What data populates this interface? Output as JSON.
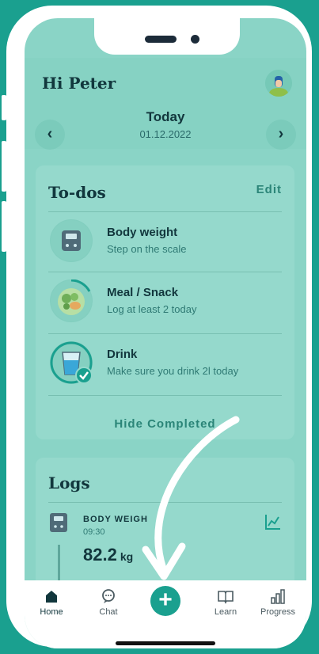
{
  "header": {
    "greeting": "Hi Peter",
    "date_title": "Today",
    "date_value": "01.12.2022",
    "prev_icon": "chevron-left-icon",
    "next_icon": "chevron-right-icon"
  },
  "todos": {
    "title": "To-dos",
    "edit_label": "Edit",
    "items": [
      {
        "title": "Body weight",
        "subtitle": "Step on the scale",
        "icon": "scale-icon"
      },
      {
        "title": "Meal / Snack",
        "subtitle": "Log at least 2 today",
        "icon": "meal-plate-icon"
      },
      {
        "title": "Drink",
        "subtitle": "Make sure you drink 2l today",
        "icon": "water-glass-icon"
      }
    ],
    "hide_completed_label": "Hide Completed"
  },
  "logs": {
    "title": "Logs",
    "entry_name": "BODY WEIGH",
    "entry_time": "09:30",
    "entry_value": "82.2",
    "entry_unit": "kg"
  },
  "tabs": [
    {
      "label": "Home",
      "icon": "home-icon",
      "active": true
    },
    {
      "label": "Chat",
      "icon": "chat-icon",
      "active": false
    },
    {
      "label": "Learn",
      "icon": "book-icon",
      "active": false
    },
    {
      "label": "Progress",
      "icon": "bar-chart-icon",
      "active": false
    }
  ],
  "colors": {
    "background": "#1aa08f",
    "screen": "#8ad4c6",
    "accent": "#1aa08f",
    "text_dark": "#12373d"
  }
}
